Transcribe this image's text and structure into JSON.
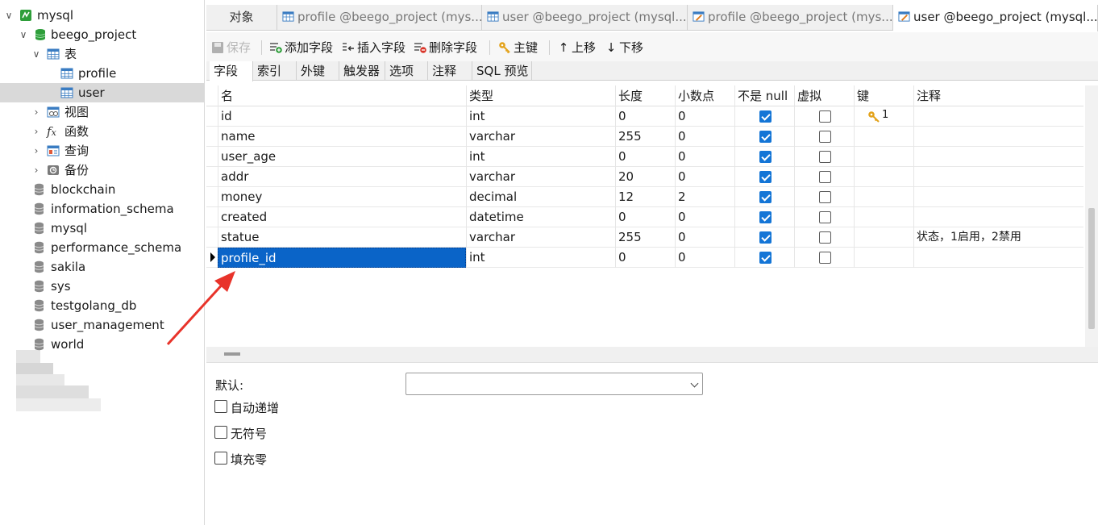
{
  "sidebar": {
    "connection": "mysql",
    "database": "beego_project",
    "tables_group": "表",
    "tables": [
      "profile",
      "user"
    ],
    "groups": [
      "视图",
      "函数",
      "查询",
      "备份"
    ],
    "other_databases": [
      "blockchain",
      "information_schema",
      "mysql",
      "performance_schema",
      "sakila",
      "sys",
      "testgolang_db",
      "user_management",
      "world"
    ]
  },
  "tabs": [
    "对象",
    "profile @beego_project (mys...",
    "user @beego_project (mysql...",
    "profile @beego_project (mys...",
    "user @beego_project (mysql..."
  ],
  "toolbar": {
    "save": "保存",
    "add_field": "添加字段",
    "insert_field": "插入字段",
    "delete_field": "删除字段",
    "primary_key": "主键",
    "move_up": "上移",
    "move_down": "下移"
  },
  "subtabs": [
    "字段",
    "索引",
    "外键",
    "触发器",
    "选项",
    "注释",
    "SQL 预览"
  ],
  "grid": {
    "headers": [
      "名",
      "类型",
      "长度",
      "小数点",
      "不是 null",
      "虚拟",
      "键",
      "注释"
    ],
    "rows": [
      {
        "name": "id",
        "type": "int",
        "length": "0",
        "decimals": "0",
        "not_null": true,
        "virtual": false,
        "key": "1",
        "comment": ""
      },
      {
        "name": "name",
        "type": "varchar",
        "length": "255",
        "decimals": "0",
        "not_null": true,
        "virtual": false,
        "key": "",
        "comment": ""
      },
      {
        "name": "user_age",
        "type": "int",
        "length": "0",
        "decimals": "0",
        "not_null": true,
        "virtual": false,
        "key": "",
        "comment": ""
      },
      {
        "name": "addr",
        "type": "varchar",
        "length": "20",
        "decimals": "0",
        "not_null": true,
        "virtual": false,
        "key": "",
        "comment": ""
      },
      {
        "name": "money",
        "type": "decimal",
        "length": "12",
        "decimals": "2",
        "not_null": true,
        "virtual": false,
        "key": "",
        "comment": ""
      },
      {
        "name": "created",
        "type": "datetime",
        "length": "0",
        "decimals": "0",
        "not_null": true,
        "virtual": false,
        "key": "",
        "comment": ""
      },
      {
        "name": "statue",
        "type": "varchar",
        "length": "255",
        "decimals": "0",
        "not_null": true,
        "virtual": false,
        "key": "",
        "comment": "状态，1启用，2禁用"
      },
      {
        "name": "profile_id",
        "type": "int",
        "length": "0",
        "decimals": "0",
        "not_null": true,
        "virtual": false,
        "key": "",
        "comment": ""
      }
    ],
    "selected_row_index": 7
  },
  "properties": {
    "default_label": "默认:",
    "default_value": "",
    "auto_increment": "自动递增",
    "unsigned": "无符号",
    "zerofill": "填充零"
  },
  "colors": {
    "selection": "#0a64c8",
    "checkbox_on": "#1475d6",
    "db_green": "#2e9e3a",
    "annotation_arrow": "#e8332a"
  },
  "icons": {
    "connection": "mysql-connection-icon",
    "database": "database-icon",
    "table": "table-icon",
    "key": "key-icon"
  }
}
